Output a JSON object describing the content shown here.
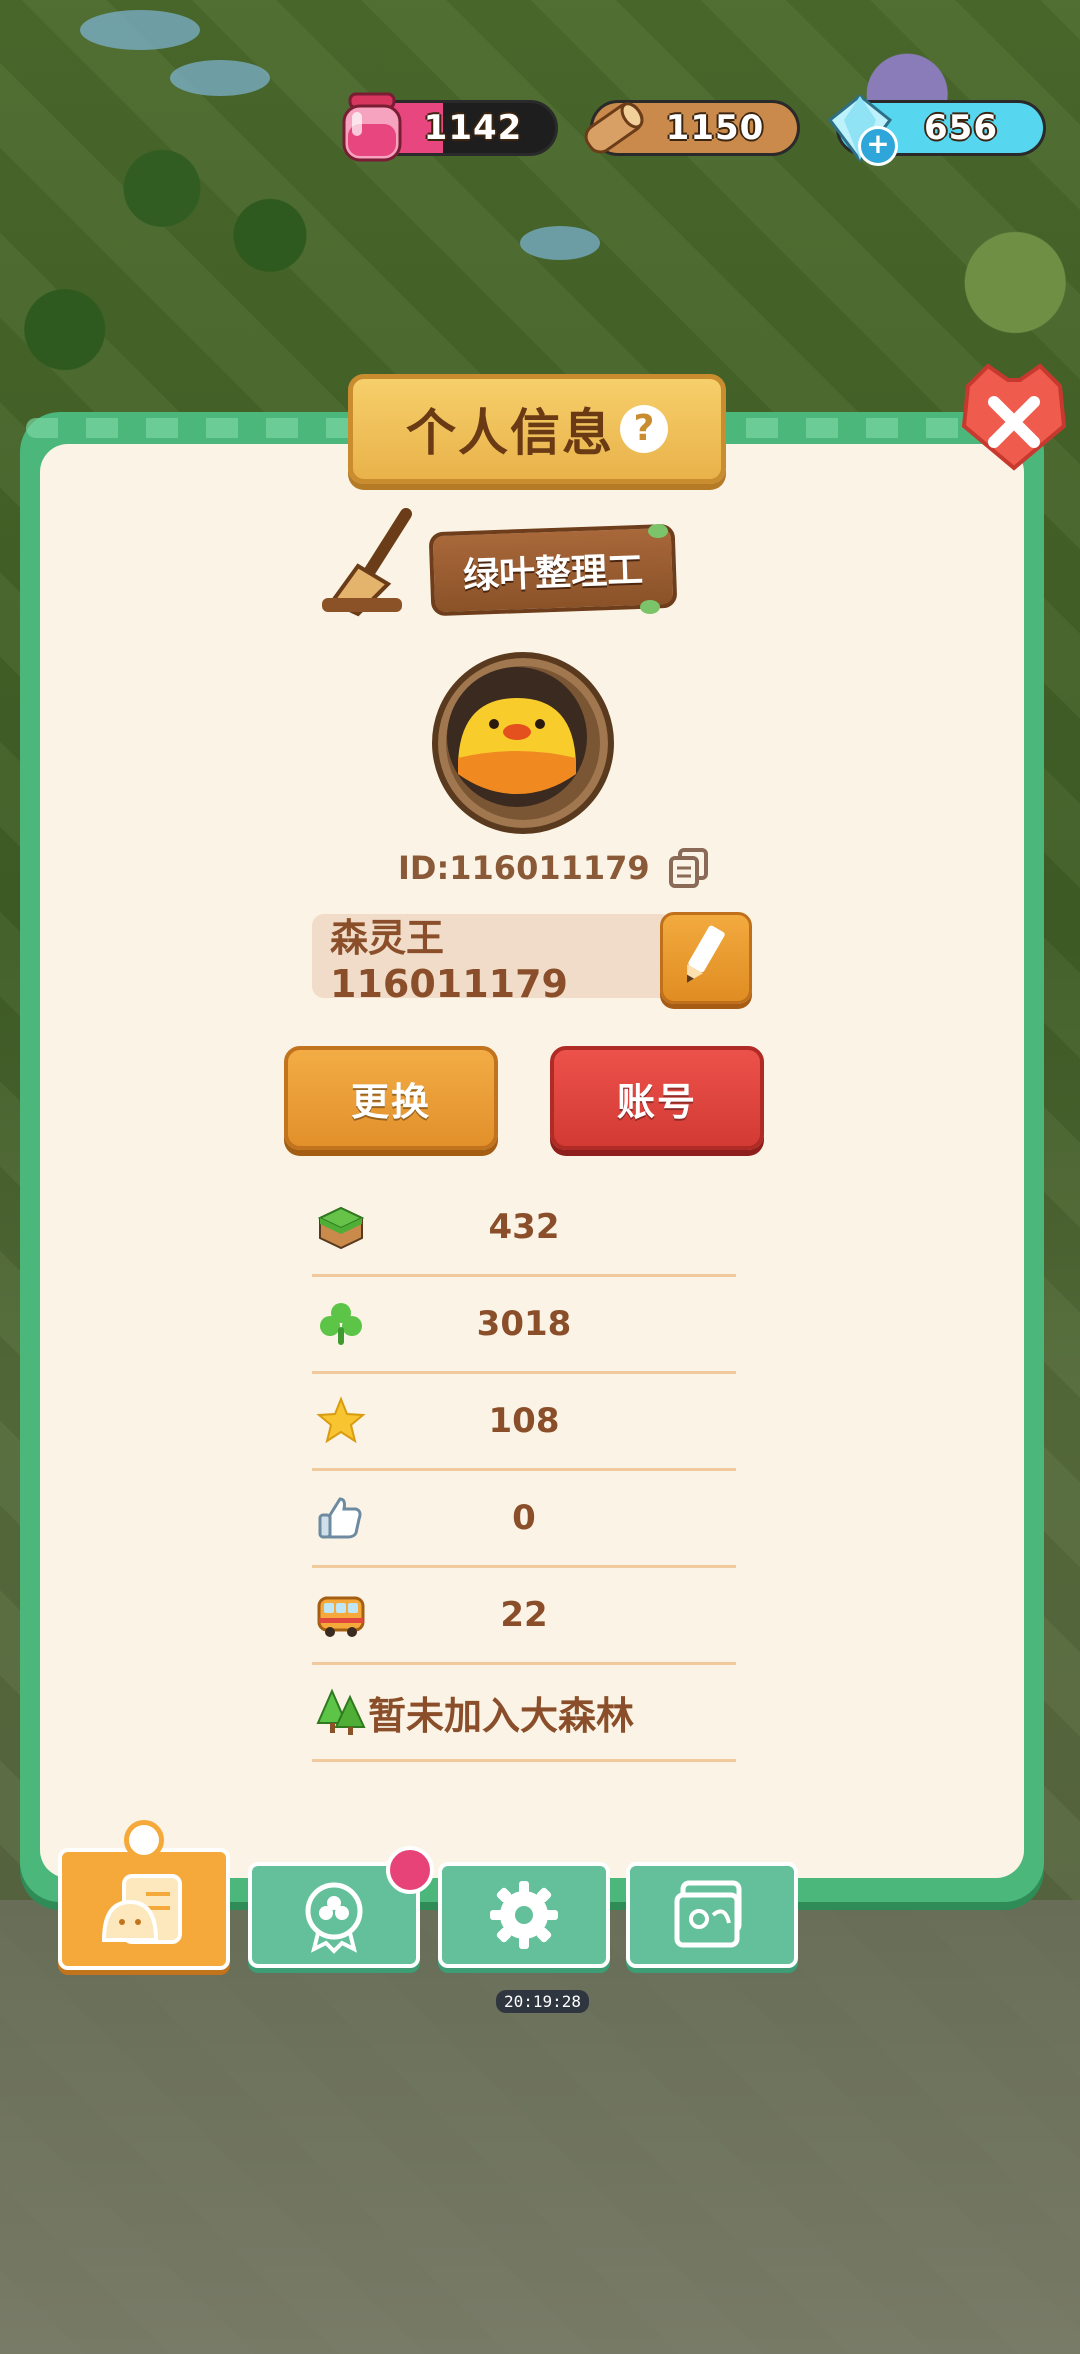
{
  "resources": {
    "potion": {
      "value": "1142",
      "icon": "pink-potion-jar-icon",
      "color": "#e8467e"
    },
    "wood": {
      "value": "1150",
      "icon": "wood-log-icon",
      "color": "#c98a4b"
    },
    "diamond": {
      "value": "656",
      "icon": "diamond-icon",
      "color": "#57d6ef",
      "plus": "+"
    }
  },
  "panel": {
    "title": "个人信息",
    "help": "?",
    "rank_title": "绿叶整理工",
    "id_text": "ID:116011179",
    "player_name": "森灵王116011179",
    "btn_change": "更换",
    "btn_account": "账号"
  },
  "stats": [
    {
      "icon": "grass-block-icon",
      "value": "432"
    },
    {
      "icon": "clover-icon",
      "value": "3018"
    },
    {
      "icon": "star-icon",
      "value": "108"
    },
    {
      "icon": "thumbs-up-icon",
      "value": "0"
    },
    {
      "icon": "bus-icon",
      "value": "22"
    }
  ],
  "forest": {
    "icon": "trees-icon",
    "text": "暂未加入大森林"
  },
  "tabs": [
    {
      "name": "profile",
      "icon": "profile-card-icon",
      "active": true
    },
    {
      "name": "badges",
      "icon": "clover-badge-icon",
      "active": false
    },
    {
      "name": "settings",
      "icon": "gear-icon",
      "active": false
    },
    {
      "name": "album",
      "icon": "photo-album-icon",
      "active": false
    }
  ],
  "timer": "20:19:28"
}
